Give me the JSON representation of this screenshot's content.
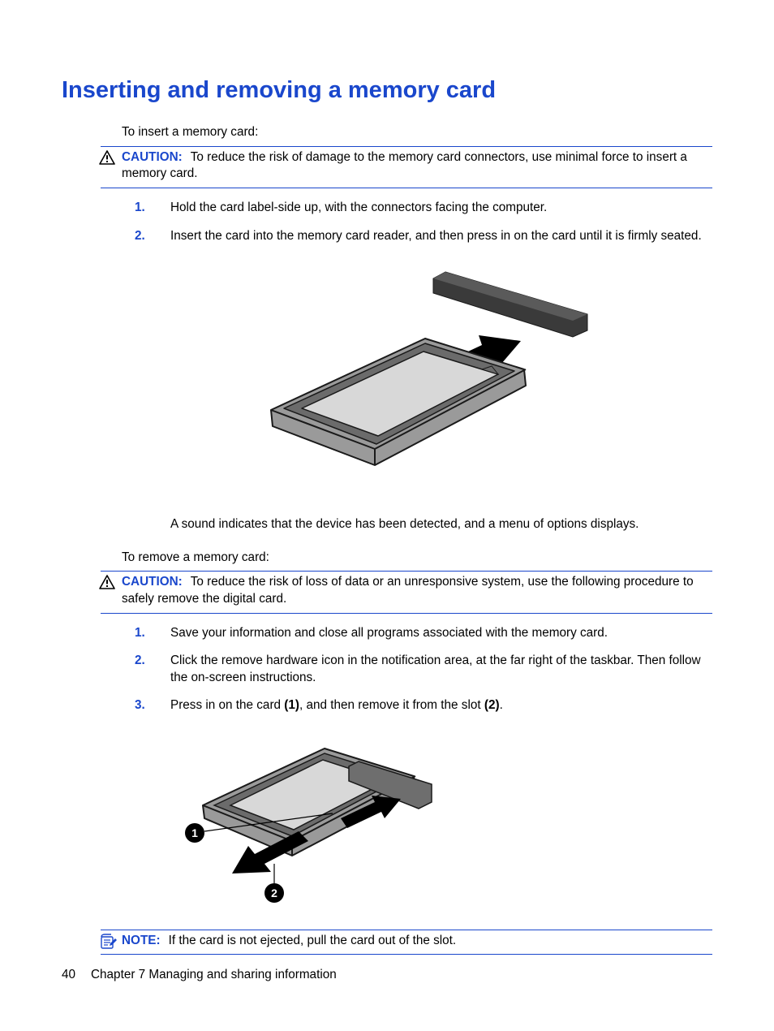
{
  "title": "Inserting and removing a memory card",
  "intro_insert": "To insert a memory card:",
  "caution1": {
    "label": "CAUTION:",
    "text": "To reduce the risk of damage to the memory card connectors, use minimal force to insert a memory card."
  },
  "insert_steps": [
    {
      "num": "1.",
      "text": "Hold the card label-side up, with the connectors facing the computer."
    },
    {
      "num": "2.",
      "text": "Insert the card into the memory card reader, and then press in on the card until it is firmly seated."
    }
  ],
  "sound_line": "A sound indicates that the device has been detected, and a menu of options displays.",
  "intro_remove": "To remove a memory card:",
  "caution2": {
    "label": "CAUTION:",
    "text": "To reduce the risk of loss of data or an unresponsive system, use the following procedure to safely remove the digital card."
  },
  "remove_steps": [
    {
      "num": "1.",
      "text": "Save your information and close all programs associated with the memory card."
    },
    {
      "num": "2.",
      "text": "Click the remove hardware icon in the notification area, at the far right of the taskbar. Then follow the on-screen instructions."
    },
    {
      "num": "3.",
      "pre": "Press in on the card ",
      "b1": "(1)",
      "mid": ", and then remove it from the slot ",
      "b2": "(2)",
      "post": "."
    }
  ],
  "note": {
    "label": "NOTE:",
    "text": "If the card is not ejected, pull the card out of the slot."
  },
  "footer": {
    "page": "40",
    "chapter": "Chapter 7   Managing and sharing information"
  }
}
